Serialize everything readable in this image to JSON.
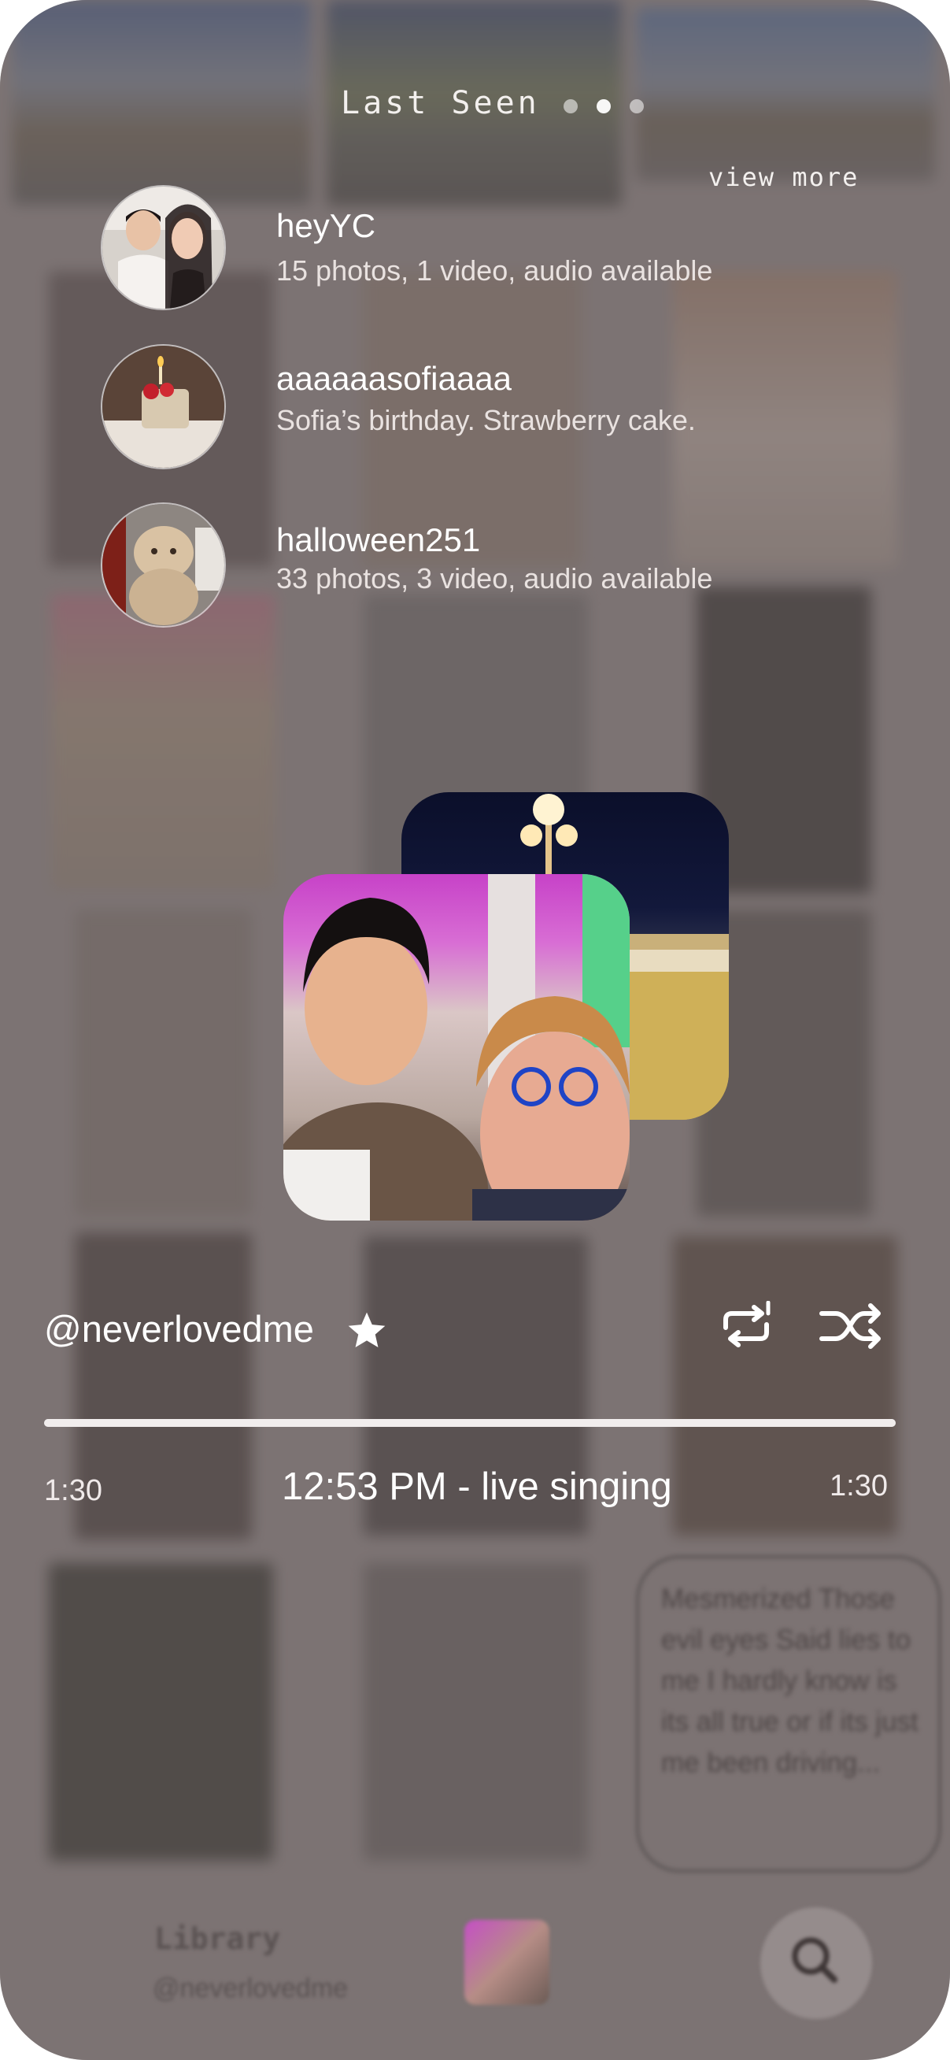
{
  "header": {
    "title": "Last Seen",
    "view_more": "view more",
    "page_dots": 3,
    "active_dot": 1
  },
  "recent": [
    {
      "name": "heyYC",
      "subtitle": "15 photos, 1 video, audio available"
    },
    {
      "name": "aaaaaasofiaaaa",
      "subtitle": "Sofia’s birthday. Strawberry cake."
    },
    {
      "name": "halloween251",
      "subtitle": "33 photos, 3 video, audio available"
    }
  ],
  "player": {
    "handle": "@neverlovedme",
    "time_elapsed": "1:30",
    "time_total": "1:30",
    "caption": "12:53 PM - live singing",
    "progress": 1.0
  },
  "lyrics": "Mesmerized Those evil eyes Said lies to me I hardly know is its all true or if its just me been driving...",
  "bottom_bar": {
    "library_label": "Library",
    "library_handle": "@neverlovedme"
  },
  "icons": {
    "favorite": "star-icon",
    "repeat": "repeat-one-icon",
    "shuffle": "shuffle-icon",
    "search": "search-icon"
  }
}
